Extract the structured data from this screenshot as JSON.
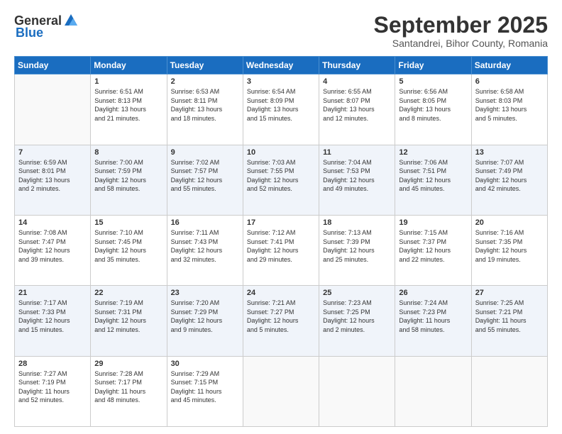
{
  "logo": {
    "general": "General",
    "blue": "Blue"
  },
  "header": {
    "month": "September 2025",
    "location": "Santandrei, Bihor County, Romania"
  },
  "days_of_week": [
    "Sunday",
    "Monday",
    "Tuesday",
    "Wednesday",
    "Thursday",
    "Friday",
    "Saturday"
  ],
  "weeks": [
    [
      {
        "day": "",
        "info": ""
      },
      {
        "day": "1",
        "info": "Sunrise: 6:51 AM\nSunset: 8:13 PM\nDaylight: 13 hours\nand 21 minutes."
      },
      {
        "day": "2",
        "info": "Sunrise: 6:53 AM\nSunset: 8:11 PM\nDaylight: 13 hours\nand 18 minutes."
      },
      {
        "day": "3",
        "info": "Sunrise: 6:54 AM\nSunset: 8:09 PM\nDaylight: 13 hours\nand 15 minutes."
      },
      {
        "day": "4",
        "info": "Sunrise: 6:55 AM\nSunset: 8:07 PM\nDaylight: 13 hours\nand 12 minutes."
      },
      {
        "day": "5",
        "info": "Sunrise: 6:56 AM\nSunset: 8:05 PM\nDaylight: 13 hours\nand 8 minutes."
      },
      {
        "day": "6",
        "info": "Sunrise: 6:58 AM\nSunset: 8:03 PM\nDaylight: 13 hours\nand 5 minutes."
      }
    ],
    [
      {
        "day": "7",
        "info": "Sunrise: 6:59 AM\nSunset: 8:01 PM\nDaylight: 13 hours\nand 2 minutes."
      },
      {
        "day": "8",
        "info": "Sunrise: 7:00 AM\nSunset: 7:59 PM\nDaylight: 12 hours\nand 58 minutes."
      },
      {
        "day": "9",
        "info": "Sunrise: 7:02 AM\nSunset: 7:57 PM\nDaylight: 12 hours\nand 55 minutes."
      },
      {
        "day": "10",
        "info": "Sunrise: 7:03 AM\nSunset: 7:55 PM\nDaylight: 12 hours\nand 52 minutes."
      },
      {
        "day": "11",
        "info": "Sunrise: 7:04 AM\nSunset: 7:53 PM\nDaylight: 12 hours\nand 49 minutes."
      },
      {
        "day": "12",
        "info": "Sunrise: 7:06 AM\nSunset: 7:51 PM\nDaylight: 12 hours\nand 45 minutes."
      },
      {
        "day": "13",
        "info": "Sunrise: 7:07 AM\nSunset: 7:49 PM\nDaylight: 12 hours\nand 42 minutes."
      }
    ],
    [
      {
        "day": "14",
        "info": "Sunrise: 7:08 AM\nSunset: 7:47 PM\nDaylight: 12 hours\nand 39 minutes."
      },
      {
        "day": "15",
        "info": "Sunrise: 7:10 AM\nSunset: 7:45 PM\nDaylight: 12 hours\nand 35 minutes."
      },
      {
        "day": "16",
        "info": "Sunrise: 7:11 AM\nSunset: 7:43 PM\nDaylight: 12 hours\nand 32 minutes."
      },
      {
        "day": "17",
        "info": "Sunrise: 7:12 AM\nSunset: 7:41 PM\nDaylight: 12 hours\nand 29 minutes."
      },
      {
        "day": "18",
        "info": "Sunrise: 7:13 AM\nSunset: 7:39 PM\nDaylight: 12 hours\nand 25 minutes."
      },
      {
        "day": "19",
        "info": "Sunrise: 7:15 AM\nSunset: 7:37 PM\nDaylight: 12 hours\nand 22 minutes."
      },
      {
        "day": "20",
        "info": "Sunrise: 7:16 AM\nSunset: 7:35 PM\nDaylight: 12 hours\nand 19 minutes."
      }
    ],
    [
      {
        "day": "21",
        "info": "Sunrise: 7:17 AM\nSunset: 7:33 PM\nDaylight: 12 hours\nand 15 minutes."
      },
      {
        "day": "22",
        "info": "Sunrise: 7:19 AM\nSunset: 7:31 PM\nDaylight: 12 hours\nand 12 minutes."
      },
      {
        "day": "23",
        "info": "Sunrise: 7:20 AM\nSunset: 7:29 PM\nDaylight: 12 hours\nand 9 minutes."
      },
      {
        "day": "24",
        "info": "Sunrise: 7:21 AM\nSunset: 7:27 PM\nDaylight: 12 hours\nand 5 minutes."
      },
      {
        "day": "25",
        "info": "Sunrise: 7:23 AM\nSunset: 7:25 PM\nDaylight: 12 hours\nand 2 minutes."
      },
      {
        "day": "26",
        "info": "Sunrise: 7:24 AM\nSunset: 7:23 PM\nDaylight: 11 hours\nand 58 minutes."
      },
      {
        "day": "27",
        "info": "Sunrise: 7:25 AM\nSunset: 7:21 PM\nDaylight: 11 hours\nand 55 minutes."
      }
    ],
    [
      {
        "day": "28",
        "info": "Sunrise: 7:27 AM\nSunset: 7:19 PM\nDaylight: 11 hours\nand 52 minutes."
      },
      {
        "day": "29",
        "info": "Sunrise: 7:28 AM\nSunset: 7:17 PM\nDaylight: 11 hours\nand 48 minutes."
      },
      {
        "day": "30",
        "info": "Sunrise: 7:29 AM\nSunset: 7:15 PM\nDaylight: 11 hours\nand 45 minutes."
      },
      {
        "day": "",
        "info": ""
      },
      {
        "day": "",
        "info": ""
      },
      {
        "day": "",
        "info": ""
      },
      {
        "day": "",
        "info": ""
      }
    ]
  ]
}
